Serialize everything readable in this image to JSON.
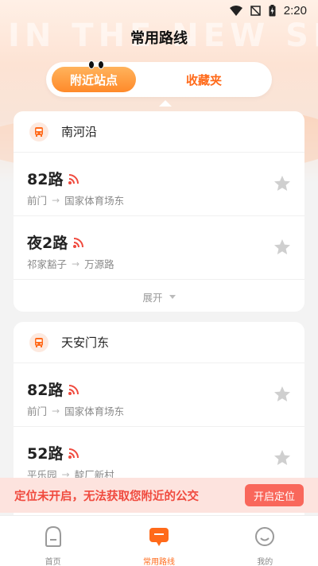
{
  "status_bar": {
    "time": "2:20",
    "icons": [
      "wifi-icon",
      "no-signal-icon",
      "battery-charging-icon"
    ]
  },
  "hero": {
    "watermark": "IN THE NEW SP"
  },
  "header": {
    "title": "常用路线"
  },
  "tabs": [
    {
      "label": "附近站点",
      "active": true
    },
    {
      "label": "收藏夹",
      "active": false
    }
  ],
  "stops": [
    {
      "name": "南河沿",
      "routes": [
        {
          "name": "82路",
          "from": "前门",
          "to": "国家体育场东"
        },
        {
          "name": "夜2路",
          "from": "祁家豁子",
          "to": "万源路"
        }
      ],
      "expand_label": "展开"
    },
    {
      "name": "天安门东",
      "routes": [
        {
          "name": "82路",
          "from": "前门",
          "to": "国家体育场东"
        },
        {
          "name": "52路",
          "from": "平乐园",
          "to": "靛厂新村"
        }
      ]
    }
  ],
  "location_banner": {
    "message": "定位未开启，无法获取您附近的公交",
    "button_label": "开启定位"
  },
  "bottom_nav": [
    {
      "label": "首页",
      "icon": "home-icon",
      "active": false
    },
    {
      "label": "常用路线",
      "icon": "route-icon",
      "active": true
    },
    {
      "label": "我的",
      "icon": "profile-icon",
      "active": false
    }
  ],
  "colors": {
    "accent": "#ff6a1a",
    "signal": "#f04a3e",
    "banner_bg": "#fde3de",
    "banner_text": "#f04a3e"
  }
}
